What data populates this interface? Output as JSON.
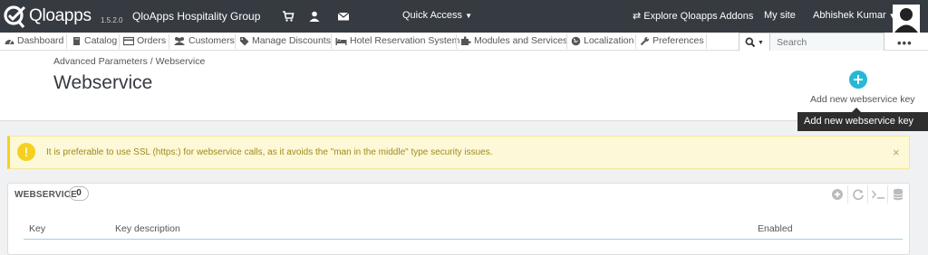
{
  "topbar": {
    "logo_text": "Qloapps",
    "version": "1.5.2.0",
    "shop_name": "QloApps Hospitality Group",
    "quick_access": "Quick Access",
    "explore": "Explore Qloapps Addons",
    "my_site": "My site",
    "user_name": "Abhishek Kumar"
  },
  "nav": {
    "items": [
      {
        "label": "Dashboard",
        "icon": "dashboard-icon"
      },
      {
        "label": "Catalog",
        "icon": "book-icon"
      },
      {
        "label": "Orders",
        "icon": "credit-card-icon"
      },
      {
        "label": "Customers",
        "icon": "users-icon"
      },
      {
        "label": "Manage Discounts",
        "icon": "tag-icon"
      },
      {
        "label": "Hotel Reservation System",
        "icon": "bed-icon"
      },
      {
        "label": "Modules and Services",
        "icon": "puzzle-icon"
      },
      {
        "label": "Localization",
        "icon": "globe-icon"
      },
      {
        "label": "Preferences",
        "icon": "wrench-icon"
      }
    ],
    "search_placeholder": "Search",
    "more": "•••"
  },
  "header": {
    "breadcrumb": "Advanced Parameters  /  Webservice",
    "title": "Webservice",
    "add_button": "Add new webservice key"
  },
  "tooltip": "Add new webservice key",
  "alert": {
    "text": "It is preferable to use SSL (https:) for webservice calls, as it avoids the \"man in the middle\" type security issues.",
    "icon": "!",
    "close": "×"
  },
  "panel": {
    "title": "WEBSERVICE",
    "count": "0",
    "tools": [
      "add-icon",
      "refresh-icon",
      "sql-icon",
      "database-icon"
    ],
    "columns": [
      "Key",
      "Key description",
      "Enabled"
    ]
  },
  "colors": {
    "topbar": "#363a41",
    "accent": "#25b9d7",
    "warning_bg": "#fcf8d8",
    "warning_border": "#f5d01f"
  }
}
